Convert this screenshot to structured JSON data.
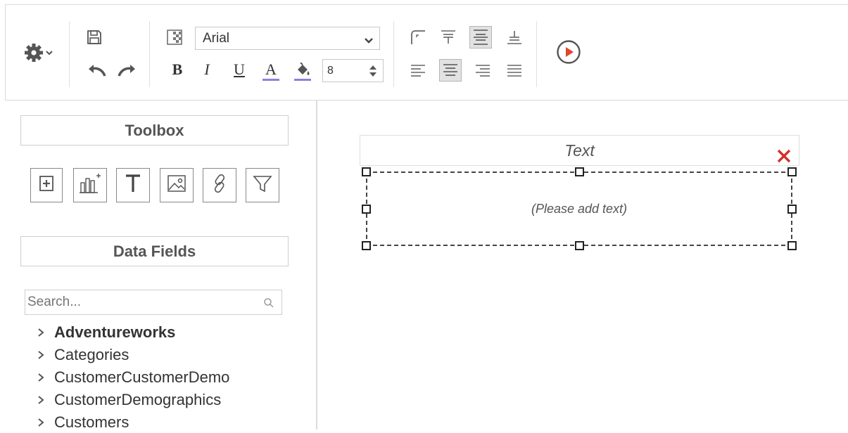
{
  "toolbar": {
    "font_family": "Arial",
    "font_size": "8",
    "icons": [
      "gear-icon",
      "save-icon",
      "undo-icon",
      "redo-icon",
      "background-icon",
      "bold-icon",
      "italic-icon",
      "underline-icon",
      "font-color-icon",
      "fill-color-icon",
      "border-icon",
      "valign-top-icon",
      "valign-middle-icon",
      "valign-bottom-icon",
      "align-left-icon",
      "align-center-icon",
      "align-right-icon",
      "justify-icon",
      "preview-icon"
    ],
    "bold_label": "B",
    "italic_label": "I",
    "underline_label": "U",
    "font_color_label": "A",
    "accent_color": "#8d7fe0",
    "preview_color": "#e2452a"
  },
  "sidebar": {
    "toolbox_title": "Toolbox",
    "tools": [
      "add-icon",
      "chart-icon",
      "text-icon",
      "image-icon",
      "link-icon",
      "filter-icon"
    ],
    "data_fields_title": "Data Fields",
    "search_placeholder": "Search...",
    "tree": [
      {
        "label": "Adventureworks",
        "bold": true
      },
      {
        "label": "Categories",
        "bold": false
      },
      {
        "label": "CustomerCustomerDemo",
        "bold": false
      },
      {
        "label": "CustomerDemographics",
        "bold": false
      },
      {
        "label": "Customers",
        "bold": false
      }
    ]
  },
  "canvas": {
    "element_title": "Text",
    "placeholder_text": "(Please add text)",
    "close_color": "#d0312d"
  }
}
